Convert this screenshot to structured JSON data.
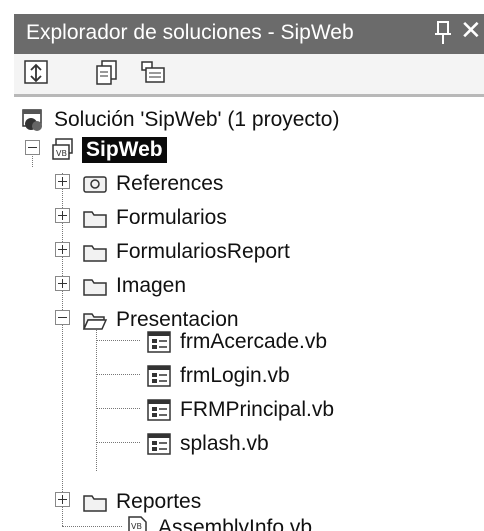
{
  "window": {
    "title": "Explorador de soluciones - SipWeb",
    "pin_icon": "pin-icon",
    "close_glyph": "✕"
  },
  "toolbar": {
    "buttons": [
      {
        "name": "refresh-icon"
      },
      {
        "name": "properties-icon"
      },
      {
        "name": "show-all-files-icon"
      }
    ]
  },
  "tree": {
    "solution": "Solución 'SipWeb' (1 proyecto)",
    "project": "SipWeb",
    "items": {
      "references": "References",
      "formularios": "Formularios",
      "formulariosreport": "FormulariosReport",
      "imagen": "Imagen",
      "presentacion": "Presentacion",
      "frmacercade": "frmAcercade.vb",
      "frmlogin": "frmLogin.vb",
      "frmprincipal": "FRMPrincipal.vb",
      "splash": "splash.vb",
      "reportes": "Reportes",
      "assemblyinfo": "AssemblyInfo.vb"
    }
  },
  "colors": {
    "titlebar": "#6b6b6b",
    "selection": "#0a0a0a",
    "folder": "#f2f2f2"
  }
}
